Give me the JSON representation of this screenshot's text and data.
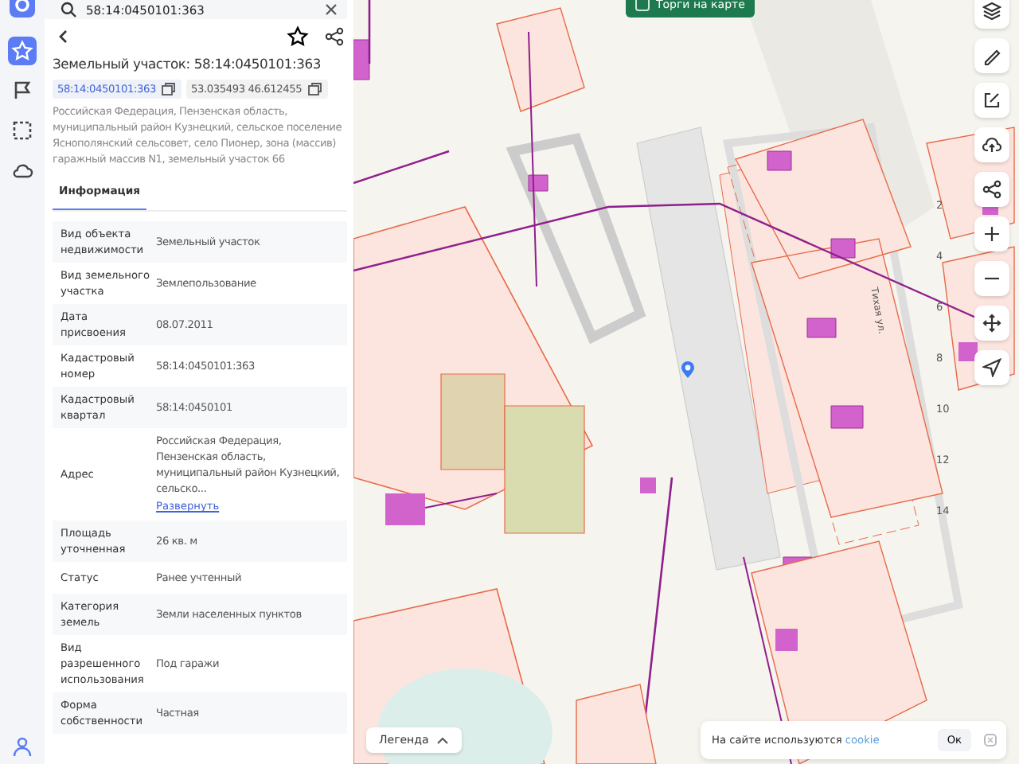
{
  "search": {
    "value": "58:14:0450101:363"
  },
  "rail": [
    {
      "kind": "star",
      "selected": true
    },
    {
      "kind": "flag",
      "selected": false
    },
    {
      "kind": "select",
      "selected": false
    },
    {
      "kind": "cloud",
      "selected": false
    }
  ],
  "card": {
    "title": "Земельный участок: 58:14:0450101:363",
    "cadastral_link": "58:14:0450101:363",
    "coords": "53.035493 46.612455",
    "address": "Российская Федерация, Пензенская область, муниципальный район Кузнецкий, сельское поселение Яснополянский сельсовет, село Пионер, зона (массив) гаражный массив N1, земельный участок 66"
  },
  "tabs": [
    {
      "label": "Информация",
      "selected": true
    }
  ],
  "rows": [
    {
      "label": "Вид объекта недвижимости",
      "value": "Земельный участок"
    },
    {
      "label": "Вид земельного участка",
      "value": "Землепользование"
    },
    {
      "label": "Дата присвоения",
      "value": "08.07.2011"
    },
    {
      "label": "Кадастровый номер",
      "value": "58:14:0450101:363"
    },
    {
      "label": "Кадастровый квартал",
      "value": "58:14:0450101"
    },
    {
      "label": "Адрес",
      "value": "Российская Федерация, Пензенская область, муниципальный район Кузнецкий, сельско...",
      "link": "Развернуть"
    },
    {
      "label": "Площадь уточненная",
      "value": "26 кв. м"
    },
    {
      "label": "Статус",
      "value": "Ранее учтенный"
    },
    {
      "label": "Категория земель",
      "value": "Земли населенных пунктов"
    },
    {
      "label": "Вид разрешенного использования",
      "value": "Под гаражи"
    },
    {
      "label": "Форма собственности",
      "value": "Частная"
    }
  ],
  "map": {
    "top_button": "Торги на карте",
    "street": "Тихая ул.",
    "parcel_numbers": [
      "2",
      "4",
      "6",
      "8",
      "10",
      "12",
      "14"
    ],
    "legend": "Легенда",
    "cookie": {
      "text": "На сайте используются",
      "link": "cookie",
      "button": "Ок"
    }
  }
}
